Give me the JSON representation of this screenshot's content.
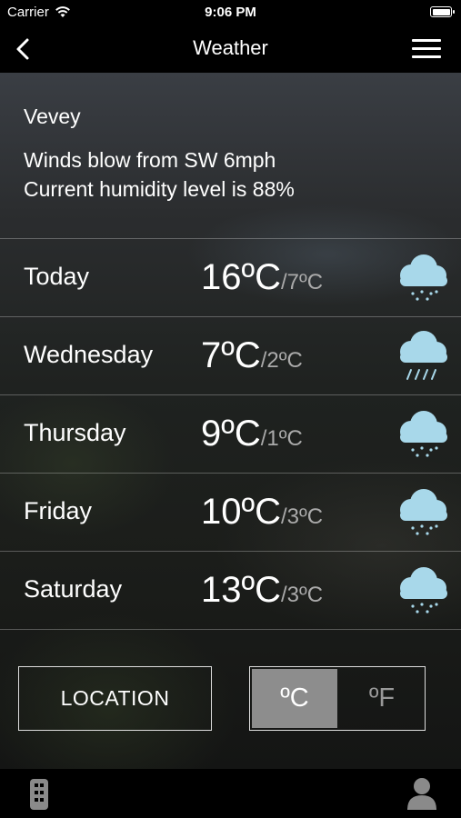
{
  "status_bar": {
    "carrier": "Carrier",
    "time": "9:06 PM",
    "battery_level": 1.0
  },
  "nav": {
    "title": "Weather"
  },
  "info": {
    "city": "Vevey",
    "wind": "Winds blow from SW 6mph",
    "humidity": "Current humidity level is 88%"
  },
  "forecast": [
    {
      "day": "Today",
      "high": "16ºC",
      "low": "7ºC",
      "icon": "rain-cloud-icon"
    },
    {
      "day": "Wednesday",
      "high": "7ºC",
      "low": "2ºC",
      "icon": "heavy-rain-cloud-icon"
    },
    {
      "day": "Thursday",
      "high": "9ºC",
      "low": "1ºC",
      "icon": "rain-cloud-icon"
    },
    {
      "day": "Friday",
      "high": "10ºC",
      "low": "3ºC",
      "icon": "rain-cloud-icon"
    },
    {
      "day": "Saturday",
      "high": "13ºC",
      "low": "3ºC",
      "icon": "rain-cloud-icon"
    }
  ],
  "buttons": {
    "location": "LOCATION",
    "celsius": "ºC",
    "fahrenheit": "ºF",
    "selected_unit": "celsius"
  },
  "colors": {
    "cloud": "#a8d8ea",
    "selected_toggle": "#8d8d8d"
  },
  "tab_bar": {
    "left_icon": "remote-control-icon",
    "right_icon": "profile-icon"
  }
}
